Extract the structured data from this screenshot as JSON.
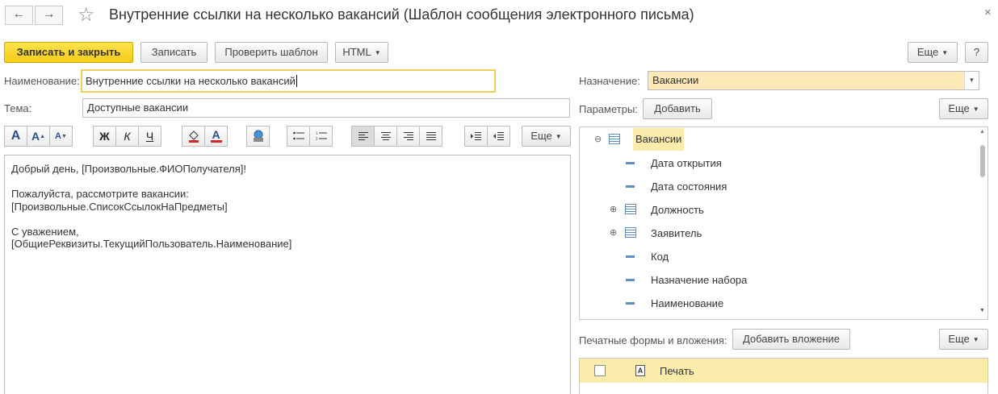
{
  "window": {
    "title": "Внутренние ссылки на несколько вакансий (Шаблон сообщения электронного письма)",
    "back_icon": "←",
    "forward_icon": "→",
    "star_icon": "☆",
    "close_icon": "×"
  },
  "toolbar": {
    "save_close_label": "Записать и закрыть",
    "save_label": "Записать",
    "check_template_label": "Проверить шаблон",
    "html_label": "HTML",
    "more_label": "Еще",
    "help_label": "?"
  },
  "form": {
    "name_label": "Наименование:",
    "name_value": "Внутренние ссылки на несколько вакансий",
    "subject_label": "Тема:",
    "subject_value": "Доступные вакансии",
    "purpose_label": "Назначение:",
    "purpose_value": "Вакансии",
    "params_label": "Параметры:",
    "add_label": "Добавить",
    "more_label": "Еще"
  },
  "format_toolbar": {
    "bold": "Ж",
    "italic": "К",
    "underline": "Ч",
    "more_label": "Еще"
  },
  "editor": {
    "lines": [
      "Добрый день, [Произвольные.ФИОПолучателя]!",
      "",
      "Пожалуйста, рассмотрите вакансии:",
      "[Произвольные.СписокСсылокНаПредметы]",
      "",
      "С уважением,",
      "[ОбщиеРеквизиты.ТекущийПользователь.Наименование]"
    ]
  },
  "tree": {
    "root": "Вакансии",
    "items": [
      "Дата открытия",
      "Дата состояния",
      "Должность",
      "Заявитель",
      "Код",
      "Назначение набора",
      "Наименование"
    ]
  },
  "attachments": {
    "label": "Печатные формы и вложения:",
    "add_label": "Добавить вложение",
    "more_label": "Еще",
    "rows": [
      "Печать"
    ]
  },
  "colors": {
    "primary_button": "#f5cd13",
    "selection_yellow": "#fbecac",
    "tree_icon_blue": "#5b8fc4"
  }
}
